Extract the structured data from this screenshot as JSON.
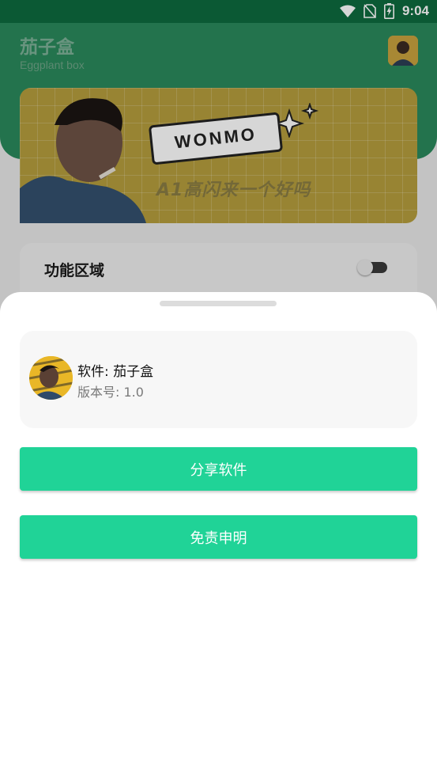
{
  "status_bar": {
    "time": "9:04",
    "icons": [
      "wifi-icon",
      "no-sim-icon",
      "battery-charging-icon"
    ]
  },
  "header": {
    "title": "茄子盒",
    "subtitle": "Eggplant box"
  },
  "banner": {
    "tag_text": "WONMO",
    "slogan": "A1高闪来一个好吗"
  },
  "function_area": {
    "title": "功能区域",
    "toggle_on": false
  },
  "sheet": {
    "software_label": "软件: 茄子盒",
    "version_label": "版本号: 1.0",
    "share_button": "分享软件",
    "disclaimer_button": "免责申明"
  },
  "colors": {
    "accent": "#20d397",
    "header_green": "#2a8a5c",
    "banner_yellow": "#f5cf3b"
  }
}
